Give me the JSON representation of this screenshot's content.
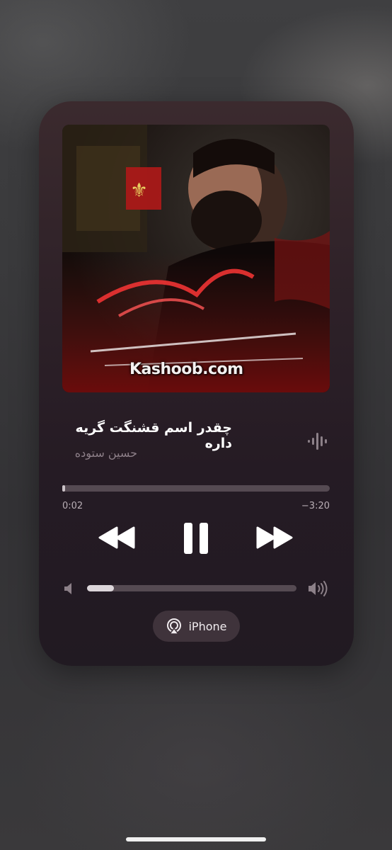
{
  "now_playing": {
    "title": "چقدر اسم قشنگت گریه داره",
    "artist": "حسین ستوده",
    "artwork": {
      "watermark_text": "Kashoob.com"
    },
    "elapsed": "0:02",
    "remaining": "−3:20",
    "progress_fraction": 0.01,
    "volume_fraction": 0.13
  },
  "output_device": {
    "label": "iPhone",
    "icon": "airplay-icon"
  },
  "icons": {
    "waveform": "audio-waveform-icon",
    "rewind": "rewind-icon",
    "pause": "pause-icon",
    "forward": "fast-forward-icon",
    "volume_low": "speaker-low-icon",
    "volume_high": "speaker-high-icon"
  },
  "colors": {
    "card_background": "#2e2128",
    "primary_text": "#ffffff",
    "secondary_text": "#8d7f88",
    "track": "#554a52",
    "fill": "#cbc3c8"
  }
}
